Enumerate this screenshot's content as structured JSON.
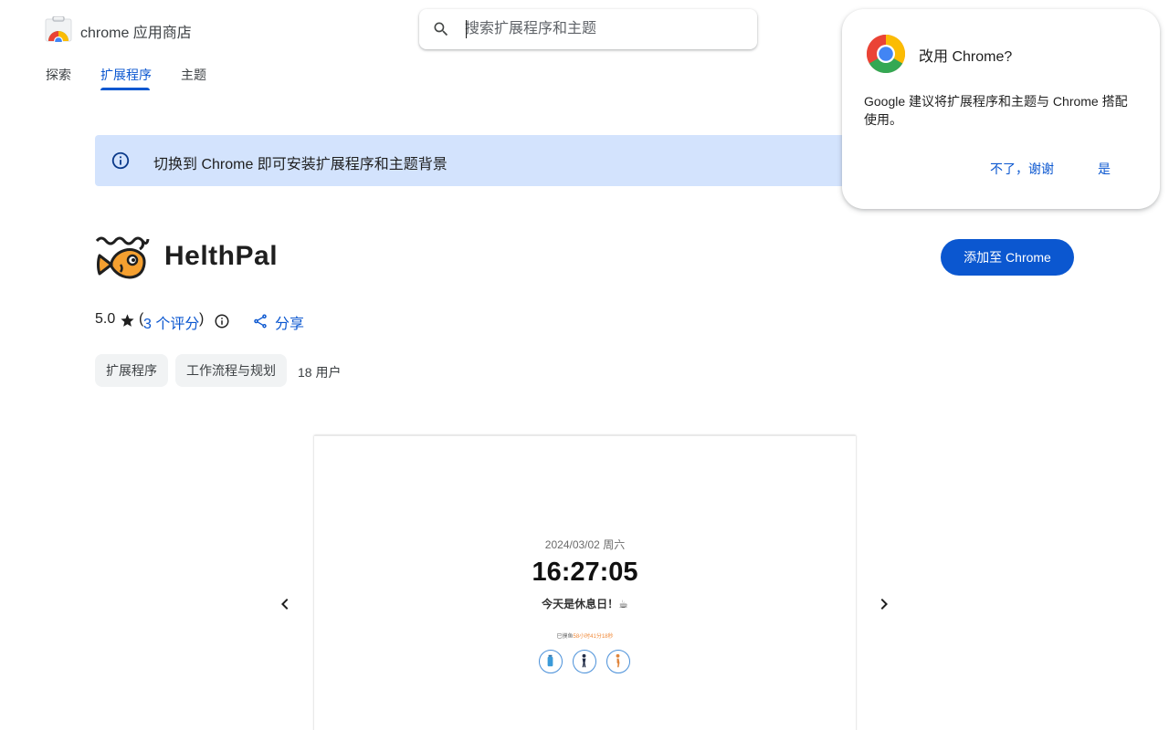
{
  "header": {
    "store_name": "chrome 应用商店",
    "search_placeholder": "搜索扩展程序和主题"
  },
  "tabs": [
    {
      "label": "探索",
      "active": false
    },
    {
      "label": "扩展程序",
      "active": true
    },
    {
      "label": "主题",
      "active": false
    }
  ],
  "banner": {
    "text": "切换到 Chrome 即可安装扩展程序和主题背景"
  },
  "app": {
    "name": "HelthPal",
    "add_button": "添加至 Chrome",
    "rating": "5.0",
    "rating_open": "(",
    "reviews_link": "3 个评分",
    "rating_close": ")",
    "share_label": "分享",
    "chips": [
      "扩展程序",
      "工作流程与规划"
    ],
    "users": "18 用户"
  },
  "screenshot": {
    "date": "2024/03/02 周六",
    "time": "16:27:05",
    "message": "今天是休息日！☕",
    "elapsed_prefix": "已摸鱼",
    "elapsed_value": "58小时41分18秒"
  },
  "popup": {
    "title": "改用 Chrome?",
    "body": "Google 建议将扩展程序和主题与 Chrome 搭配使用。",
    "no_button": "不了，谢谢",
    "yes_button": "是"
  },
  "colors": {
    "accent": "#0b57d0",
    "banner_bg": "#d3e3fd",
    "chip_bg": "#f1f3f4"
  }
}
